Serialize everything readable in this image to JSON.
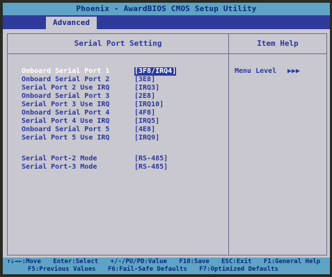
{
  "title": "Phoenix - AwardBIOS CMOS Setup Utility",
  "tabs": [
    {
      "label": "Advanced",
      "active": true
    }
  ],
  "main_panel": {
    "header": "Serial Port Setting",
    "rows": [
      {
        "label": "Onboard Serial Port 1",
        "value": "[3F8/IRQ4]",
        "selected": true
      },
      {
        "label": "Onboard Serial Port 2",
        "value": "[3E8]"
      },
      {
        "label": "Serial Port 2 Use IRQ",
        "value": "[IRQ3]"
      },
      {
        "label": "Onboard Serial Port 3",
        "value": "[2E8]"
      },
      {
        "label": "Serial Port 3 Use IRQ",
        "value": "[IRQ10]"
      },
      {
        "label": "Onboard Serial Port 4",
        "value": "[4F8]"
      },
      {
        "label": "Serial Port 4 Use IRQ",
        "value": "[IRQ5]"
      },
      {
        "label": "Onboard Serial Port 5",
        "value": "[4E8]"
      },
      {
        "label": "Serial Port 5 Use IRQ",
        "value": "[IRQ9]"
      }
    ],
    "mode_rows": [
      {
        "label": "Serial Port-2 Mode",
        "value": "[RS-485]"
      },
      {
        "label": "Serial Port-3 Mode",
        "value": "[RS-485]"
      }
    ]
  },
  "help_panel": {
    "header": "Item Help",
    "menu_level_label": "Menu Level",
    "menu_level_arrows": "▶▶▶"
  },
  "footer": {
    "line1": [
      "↑↓→←:Move",
      "Enter:Select",
      "+/-/PU/PD:Value",
      "F10:Save",
      "ESC:Exit",
      "F1:General Help"
    ],
    "line2": [
      "F5:Previous Values",
      "F6:Fail-Safe Defaults",
      "F7:Optimized Defaults"
    ]
  },
  "colors": {
    "screen_background": "#c9c7cf",
    "title_bar": "#5fa3c6",
    "tab_bar": "#2f3b9a",
    "text_blue": "#2a3aa0",
    "selected_text": "#ffffff"
  }
}
